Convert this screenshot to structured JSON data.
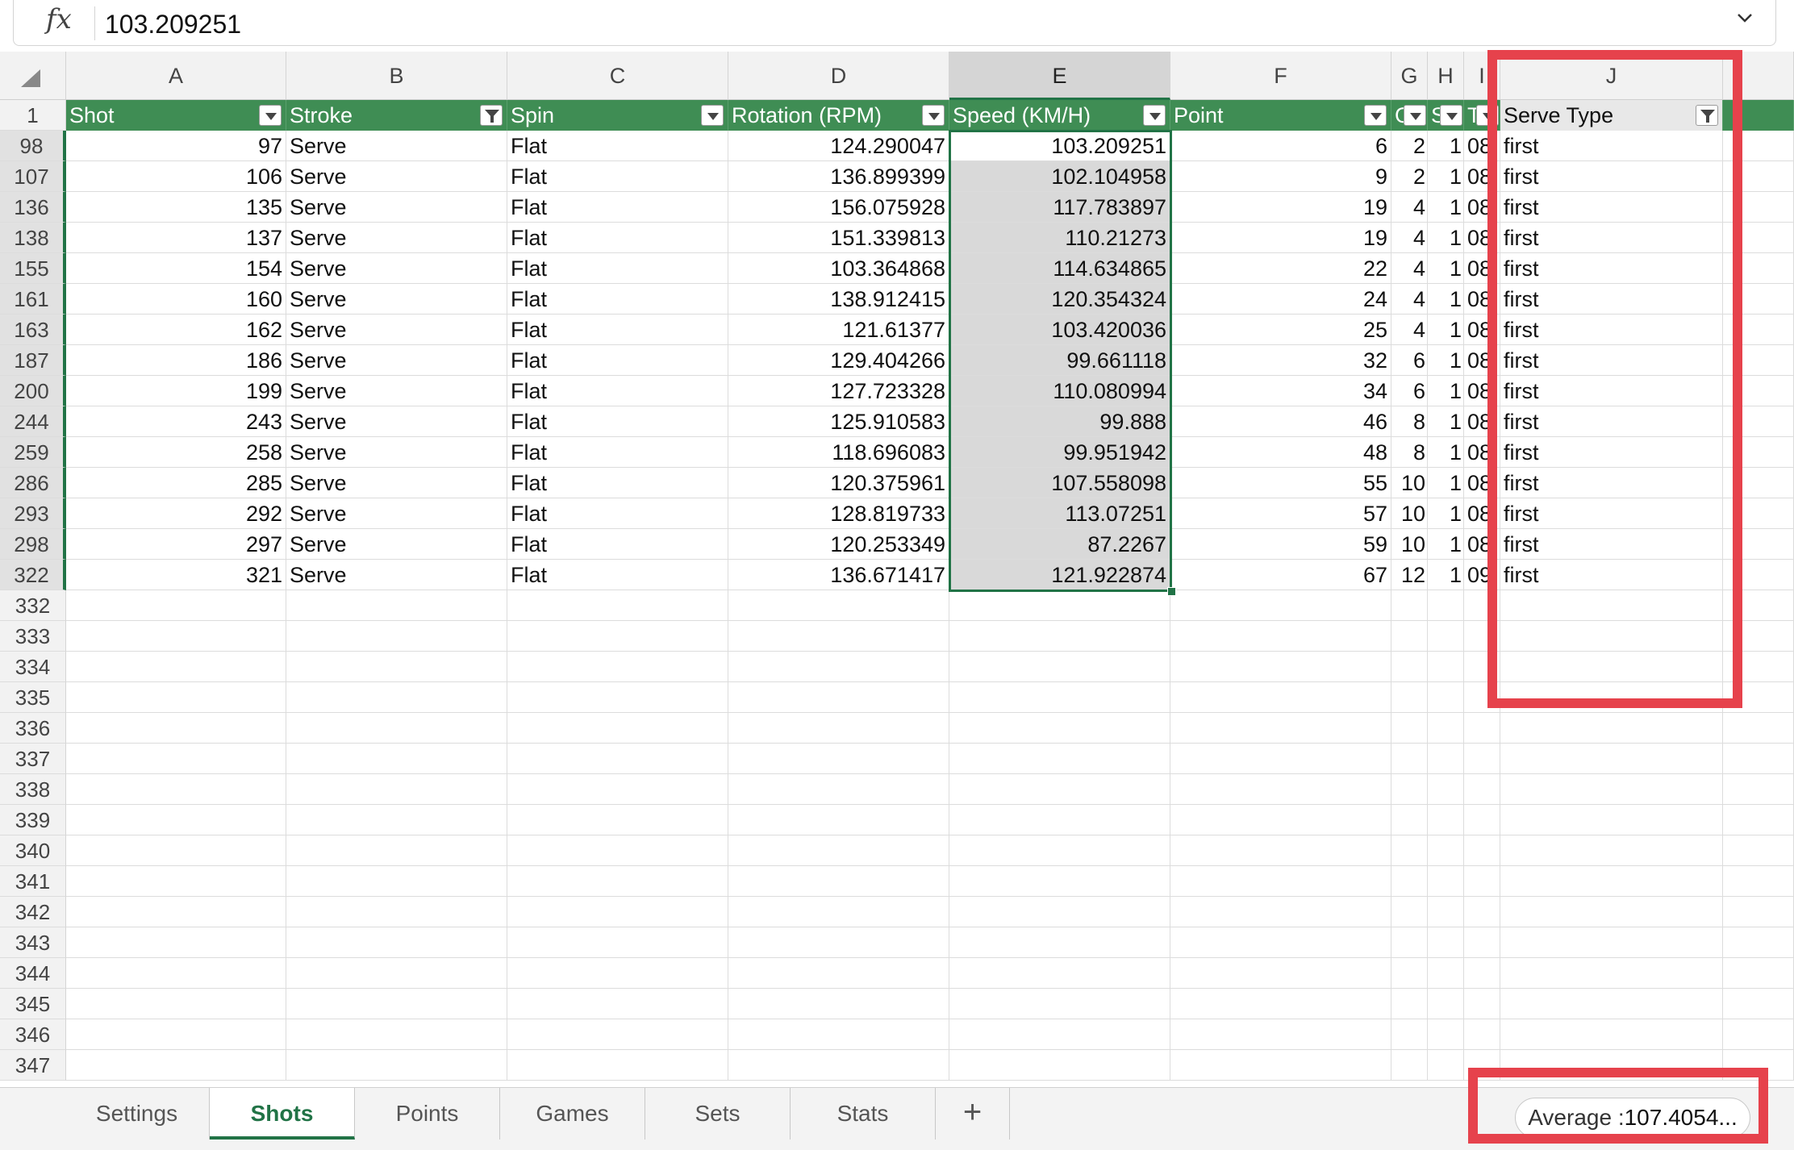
{
  "formula_bar": {
    "fx_label": "fx",
    "value": "103.209251"
  },
  "columns": [
    "A",
    "B",
    "C",
    "D",
    "E",
    "F",
    "G",
    "H",
    "I",
    "",
    "J"
  ],
  "selected_column": "E",
  "header_row_number": "1",
  "headers": [
    {
      "label": "Shot",
      "filter": "dropdown"
    },
    {
      "label": "Stroke",
      "filter": "filtered"
    },
    {
      "label": "Spin",
      "filter": "dropdown"
    },
    {
      "label": "Rotation (RPM)",
      "filter": "dropdown"
    },
    {
      "label": "Speed (KM/H)",
      "filter": "dropdown"
    },
    {
      "label": "Point",
      "filter": "dropdown"
    },
    {
      "label": "G",
      "filter": "dropdown"
    },
    {
      "label": "S",
      "filter": "dropdown"
    },
    {
      "label": "T",
      "filter": "dropdown"
    },
    {
      "label": "",
      "filter": "none"
    },
    {
      "label": "Serve Type",
      "filter": "filtered"
    }
  ],
  "rows": [
    {
      "row": "98",
      "shot": "97",
      "stroke": "Serve",
      "spin": "Flat",
      "rotation": "124.290047",
      "speed": "103.209251",
      "point": "6",
      "g": "2",
      "s": "1",
      "t": "08",
      "serve": "first"
    },
    {
      "row": "107",
      "shot": "106",
      "stroke": "Serve",
      "spin": "Flat",
      "rotation": "136.899399",
      "speed": "102.104958",
      "point": "9",
      "g": "2",
      "s": "1",
      "t": "08",
      "serve": "first"
    },
    {
      "row": "136",
      "shot": "135",
      "stroke": "Serve",
      "spin": "Flat",
      "rotation": "156.075928",
      "speed": "117.783897",
      "point": "19",
      "g": "4",
      "s": "1",
      "t": "08",
      "serve": "first"
    },
    {
      "row": "138",
      "shot": "137",
      "stroke": "Serve",
      "spin": "Flat",
      "rotation": "151.339813",
      "speed": "110.21273",
      "point": "19",
      "g": "4",
      "s": "1",
      "t": "08",
      "serve": "first"
    },
    {
      "row": "155",
      "shot": "154",
      "stroke": "Serve",
      "spin": "Flat",
      "rotation": "103.364868",
      "speed": "114.634865",
      "point": "22",
      "g": "4",
      "s": "1",
      "t": "08",
      "serve": "first"
    },
    {
      "row": "161",
      "shot": "160",
      "stroke": "Serve",
      "spin": "Flat",
      "rotation": "138.912415",
      "speed": "120.354324",
      "point": "24",
      "g": "4",
      "s": "1",
      "t": "08",
      "serve": "first"
    },
    {
      "row": "163",
      "shot": "162",
      "stroke": "Serve",
      "spin": "Flat",
      "rotation": "121.61377",
      "speed": "103.420036",
      "point": "25",
      "g": "4",
      "s": "1",
      "t": "08",
      "serve": "first"
    },
    {
      "row": "187",
      "shot": "186",
      "stroke": "Serve",
      "spin": "Flat",
      "rotation": "129.404266",
      "speed": "99.661118",
      "point": "32",
      "g": "6",
      "s": "1",
      "t": "08",
      "serve": "first"
    },
    {
      "row": "200",
      "shot": "199",
      "stroke": "Serve",
      "spin": "Flat",
      "rotation": "127.723328",
      "speed": "110.080994",
      "point": "34",
      "g": "6",
      "s": "1",
      "t": "08",
      "serve": "first"
    },
    {
      "row": "244",
      "shot": "243",
      "stroke": "Serve",
      "spin": "Flat",
      "rotation": "125.910583",
      "speed": "99.888",
      "point": "46",
      "g": "8",
      "s": "1",
      "t": "08",
      "serve": "first"
    },
    {
      "row": "259",
      "shot": "258",
      "stroke": "Serve",
      "spin": "Flat",
      "rotation": "118.696083",
      "speed": "99.951942",
      "point": "48",
      "g": "8",
      "s": "1",
      "t": "08",
      "serve": "first"
    },
    {
      "row": "286",
      "shot": "285",
      "stroke": "Serve",
      "spin": "Flat",
      "rotation": "120.375961",
      "speed": "107.558098",
      "point": "55",
      "g": "10",
      "s": "1",
      "t": "08",
      "serve": "first"
    },
    {
      "row": "293",
      "shot": "292",
      "stroke": "Serve",
      "spin": "Flat",
      "rotation": "128.819733",
      "speed": "113.07251",
      "point": "57",
      "g": "10",
      "s": "1",
      "t": "08",
      "serve": "first"
    },
    {
      "row": "298",
      "shot": "297",
      "stroke": "Serve",
      "spin": "Flat",
      "rotation": "120.253349",
      "speed": "87.2267",
      "point": "59",
      "g": "10",
      "s": "1",
      "t": "08",
      "serve": "first"
    },
    {
      "row": "322",
      "shot": "321",
      "stroke": "Serve",
      "spin": "Flat",
      "rotation": "136.671417",
      "speed": "121.922874",
      "point": "67",
      "g": "12",
      "s": "1",
      "t": "09",
      "serve": "first"
    }
  ],
  "empty_rows": [
    "332",
    "333",
    "334",
    "335",
    "336",
    "337",
    "338",
    "339",
    "340",
    "341",
    "342",
    "343",
    "344",
    "345",
    "346",
    "347"
  ],
  "sheet_tabs": [
    {
      "label": "Settings",
      "active": false
    },
    {
      "label": "Shots",
      "active": true
    },
    {
      "label": "Points",
      "active": false
    },
    {
      "label": "Games",
      "active": false
    },
    {
      "label": "Sets",
      "active": false
    },
    {
      "label": "Stats",
      "active": false
    }
  ],
  "add_sheet_label": "+",
  "status": {
    "label": "Average :",
    "value": "107.4054..."
  },
  "colors": {
    "header_green": "#3f8d54",
    "accent_green": "#217346",
    "highlight_red": "#e6424c",
    "selection_gray": "#d9d9d9"
  }
}
